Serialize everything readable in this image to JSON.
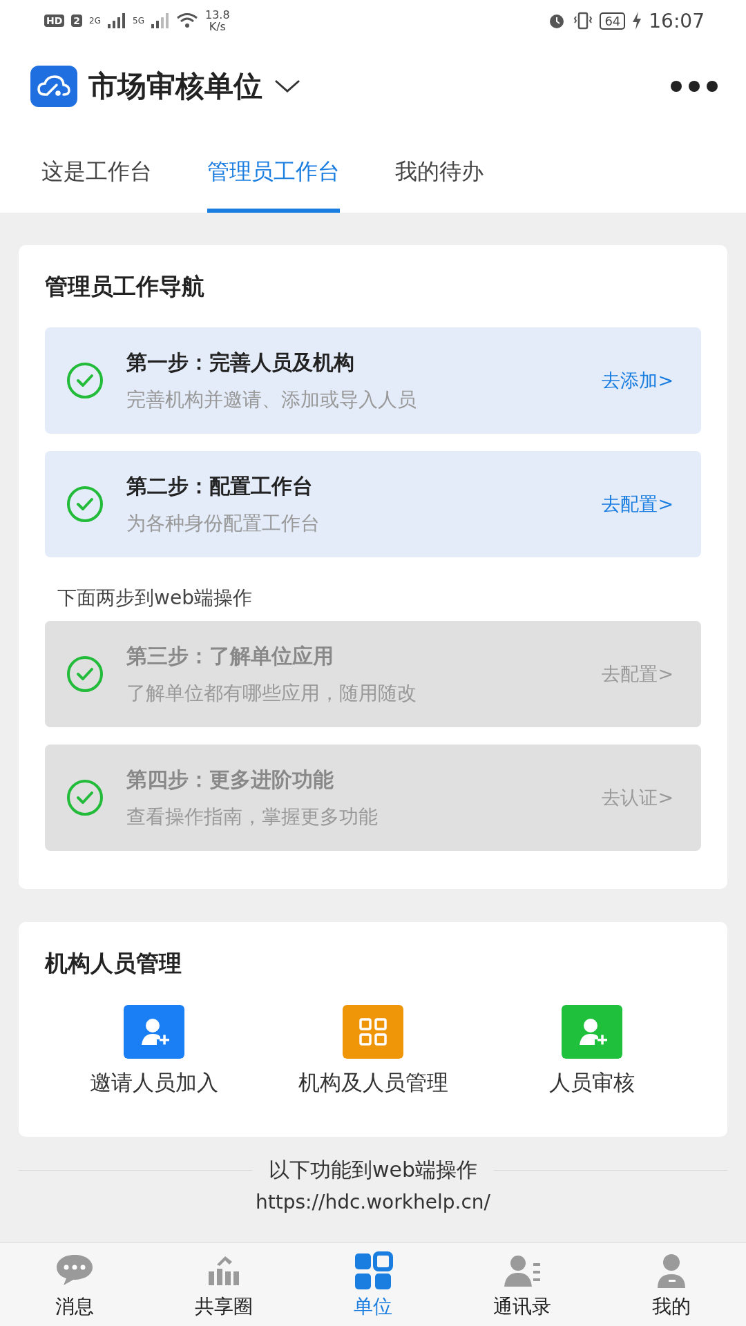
{
  "status_bar": {
    "hd": "HD",
    "sim": "2",
    "net1": "2G",
    "net2": "5G",
    "speed": "13.8",
    "speed_unit": "K/s",
    "battery": "64",
    "time": "16:07"
  },
  "header": {
    "title": "市场审核单位"
  },
  "tabs": [
    {
      "label": "这是工作台",
      "selected": false
    },
    {
      "label": "管理员工作台",
      "selected": true
    },
    {
      "label": "我的待办",
      "selected": false
    }
  ],
  "guide": {
    "title": "管理员工作导航",
    "steps": [
      {
        "title": "第一步：完善人员及机构",
        "subtitle": "完善机构并邀请、添加或导入人员",
        "action": "去添加>",
        "disabled": false,
        "completed": true
      },
      {
        "title": "第二步：配置工作台",
        "subtitle": "为各种身份配置工作台",
        "action": "去配置>",
        "disabled": false,
        "completed": true
      }
    ],
    "web_note": "下面两步到web端操作",
    "web_steps": [
      {
        "title": "第三步：了解单位应用",
        "subtitle": "了解单位都有哪些应用，随用随改",
        "action": "去配置>",
        "disabled": true,
        "completed": true
      },
      {
        "title": "第四步：更多进阶功能",
        "subtitle": "查看操作指南，掌握更多功能",
        "action": "去认证>",
        "disabled": true,
        "completed": true
      }
    ]
  },
  "management": {
    "title": "机构人员管理",
    "items": [
      {
        "label": "邀请人员加入",
        "kind": "invite",
        "color": "#1a7ef5"
      },
      {
        "label": "机构及人员管理",
        "kind": "grid",
        "color": "#ee9508"
      },
      {
        "label": "人员审核",
        "kind": "review",
        "color": "#1ec03c"
      }
    ]
  },
  "web_section": {
    "title": "以下功能到web端操作",
    "url": "https://hdc.workhelp.cn/"
  },
  "bottom_nav": [
    {
      "label": "消息",
      "selected": false
    },
    {
      "label": "共享圈",
      "selected": false
    },
    {
      "label": "单位",
      "selected": true
    },
    {
      "label": "通讯录",
      "selected": false
    },
    {
      "label": "我的",
      "selected": false
    }
  ]
}
